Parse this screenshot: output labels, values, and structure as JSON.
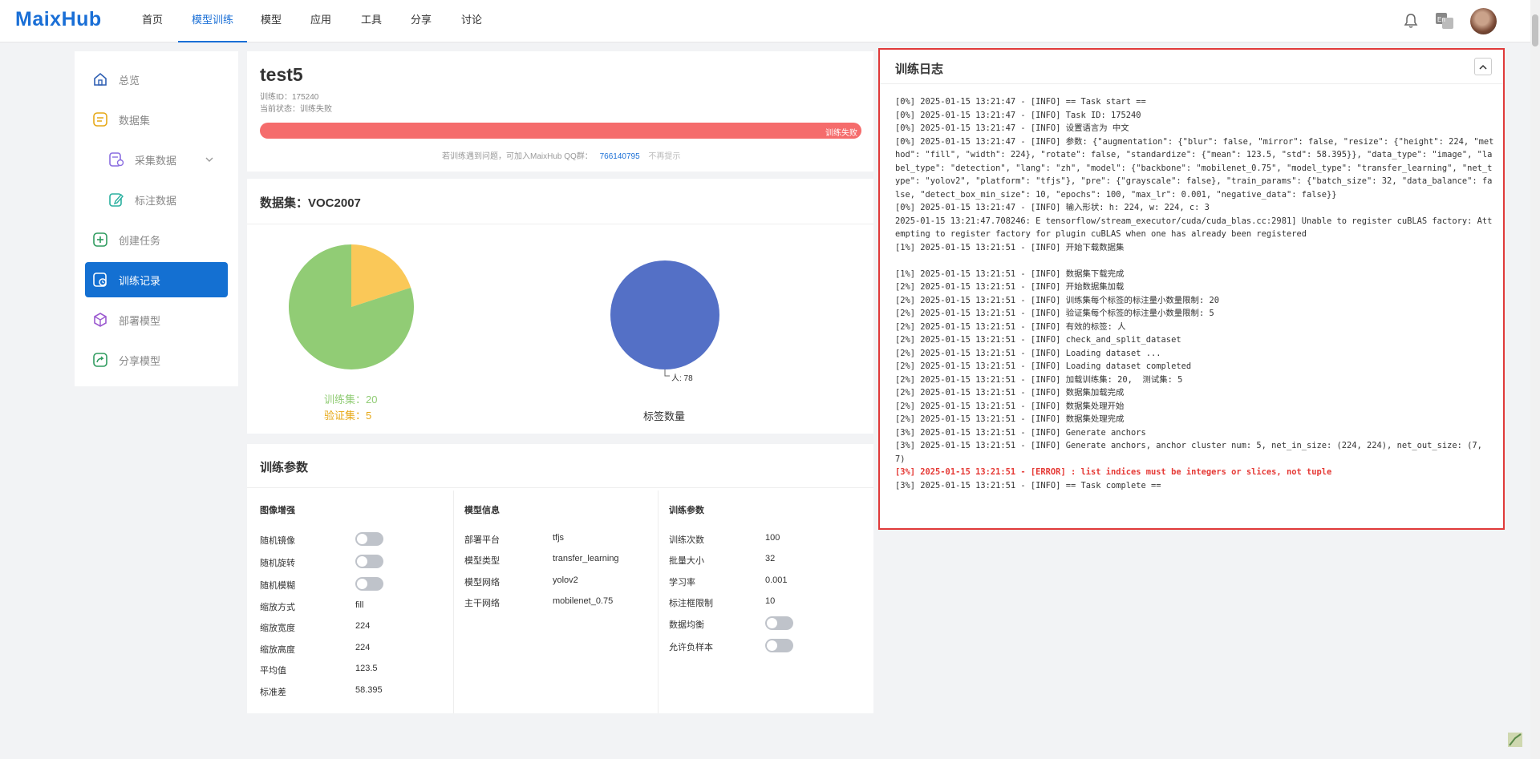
{
  "brand": {
    "logo": "MaixHub"
  },
  "nav": {
    "items": [
      {
        "label": "首页"
      },
      {
        "label": "模型训练"
      },
      {
        "label": "模型"
      },
      {
        "label": "应用"
      },
      {
        "label": "工具"
      },
      {
        "label": "分享"
      },
      {
        "label": "讨论"
      }
    ],
    "active_index": 1,
    "lang_badge": "En"
  },
  "sidebar": {
    "items": [
      {
        "label": "总览",
        "icon": "home-icon"
      },
      {
        "label": "数据集",
        "icon": "dataset-icon"
      },
      {
        "label": "采集数据",
        "icon": "collect-icon"
      },
      {
        "label": "标注数据",
        "icon": "annotate-icon"
      },
      {
        "label": "创建任务",
        "icon": "plus-icon"
      },
      {
        "label": "训练记录",
        "icon": "training-record-icon"
      },
      {
        "label": "部署模型",
        "icon": "cube-icon"
      },
      {
        "label": "分享模型",
        "icon": "share-icon"
      }
    ],
    "active": "训练记录"
  },
  "task": {
    "name": "test5",
    "id_line": "训练ID：175240",
    "status_line": "当前状态：训练失败",
    "progress_text": "训练失败",
    "progress_fraction": 1.0,
    "hint_prefix": "若训练遇到问题，可加入MaixHub QQ群：",
    "qq_group": "766140795",
    "hint_dismiss": "不再提示"
  },
  "dataset": {
    "title": "数据集：VOC2007",
    "split_legend": {
      "train": "训练集：20",
      "val": "验证集：5"
    },
    "label_chart_title": "标签数量",
    "pie_label": "人: 78"
  },
  "chart_data": [
    {
      "type": "pie",
      "labels": [
        "训练集",
        "验证集"
      ],
      "values": [
        20,
        5
      ],
      "colors": [
        "#91cc75",
        "#fac858"
      ]
    },
    {
      "type": "pie",
      "title": "标签数量",
      "labels": [
        "人"
      ],
      "values": [
        78
      ],
      "colors": [
        "#5470c6"
      ]
    }
  ],
  "params": {
    "title": "训练参数",
    "aug": {
      "title": "图像增强",
      "rows": [
        {
          "label": "随机镜像",
          "type": "toggle",
          "on": false
        },
        {
          "label": "随机旋转",
          "type": "toggle",
          "on": false
        },
        {
          "label": "随机模糊",
          "type": "toggle",
          "on": false
        },
        {
          "label": "缩放方式",
          "value": "fill"
        },
        {
          "label": "缩放宽度",
          "value": "224"
        },
        {
          "label": "缩放高度",
          "value": "224"
        },
        {
          "label": "平均值",
          "value": "123.5"
        },
        {
          "label": "标准差",
          "value": "58.395"
        }
      ]
    },
    "model": {
      "title": "模型信息",
      "rows": [
        {
          "label": "部署平台",
          "value": "tfjs"
        },
        {
          "label": "模型类型",
          "value": "transfer_learning"
        },
        {
          "label": "模型网络",
          "value": "yolov2"
        },
        {
          "label": "主干网络",
          "value": "mobilenet_0.75"
        }
      ]
    },
    "train": {
      "title": "训练参数",
      "rows": [
        {
          "label": "训练次数",
          "value": "100"
        },
        {
          "label": "批量大小",
          "value": "32"
        },
        {
          "label": "学习率",
          "value": "0.001"
        },
        {
          "label": "标注框限制",
          "value": "10"
        },
        {
          "label": "数据均衡",
          "type": "toggle",
          "on": false
        },
        {
          "label": "允许负样本",
          "type": "toggle",
          "on": false
        }
      ]
    }
  },
  "log": {
    "title": "训练日志",
    "lines": [
      {
        "text": "[0%] 2025-01-15 13:21:47 - [INFO] == Task start =="
      },
      {
        "text": "[0%] 2025-01-15 13:21:47 - [INFO] Task ID: 175240"
      },
      {
        "text": "[0%] 2025-01-15 13:21:47 - [INFO] 设置语言为 中文"
      },
      {
        "text": "[0%] 2025-01-15 13:21:47 - [INFO] 参数: {\"augmentation\": {\"blur\": false, \"mirror\": false, \"resize\": {\"height\": 224, \"method\": \"fill\", \"width\": 224}, \"rotate\": false, \"standardize\": {\"mean\": 123.5, \"std\": 58.395}}, \"data_type\": \"image\", \"label_type\": \"detection\", \"lang\": \"zh\", \"model\": {\"backbone\": \"mobilenet_0.75\", \"model_type\": \"transfer_learning\", \"net_type\": \"yolov2\", \"platform\": \"tfjs\"}, \"pre\": {\"grayscale\": false}, \"train_params\": {\"batch_size\": 32, \"data_balance\": false, \"detect_box_min_size\": 10, \"epochs\": 100, \"max_lr\": 0.001, \"negative_data\": false}}"
      },
      {
        "text": "[0%] 2025-01-15 13:21:47 - [INFO] 输入形状: h: 224, w: 224, c: 3"
      },
      {
        "text": "2025-01-15 13:21:47.708246: E tensorflow/stream_executor/cuda/cuda_blas.cc:2981] Unable to register cuBLAS factory: Attempting to register factory for plugin cuBLAS when one has already been registered"
      },
      {
        "text": "[1%] 2025-01-15 13:21:51 - [INFO] 开始下载数据集"
      },
      {
        "text": ""
      },
      {
        "text": "[1%] 2025-01-15 13:21:51 - [INFO] 数据集下载完成"
      },
      {
        "text": "[2%] 2025-01-15 13:21:51 - [INFO] 开始数据集加载"
      },
      {
        "text": "[2%] 2025-01-15 13:21:51 - [INFO] 训练集每个标签的标注量小数量限制: 20"
      },
      {
        "text": "[2%] 2025-01-15 13:21:51 - [INFO] 验证集每个标签的标注量小数量限制: 5"
      },
      {
        "text": "[2%] 2025-01-15 13:21:51 - [INFO] 有效的标签: 人"
      },
      {
        "text": "[2%] 2025-01-15 13:21:51 - [INFO] check_and_split_dataset"
      },
      {
        "text": "[2%] 2025-01-15 13:21:51 - [INFO] Loading dataset ..."
      },
      {
        "text": "[2%] 2025-01-15 13:21:51 - [INFO] Loading dataset completed"
      },
      {
        "text": "[2%] 2025-01-15 13:21:51 - [INFO] 加载训练集: 20,  测试集: 5"
      },
      {
        "text": "[2%] 2025-01-15 13:21:51 - [INFO] 数据集加载完成"
      },
      {
        "text": "[2%] 2025-01-15 13:21:51 - [INFO] 数据集处理开始"
      },
      {
        "text": "[2%] 2025-01-15 13:21:51 - [INFO] 数据集处理完成"
      },
      {
        "text": "[3%] 2025-01-15 13:21:51 - [INFO] Generate anchors"
      },
      {
        "text": "[3%] 2025-01-15 13:21:51 - [INFO] Generate anchors, anchor cluster num: 5, net_in_size: (224, 224), net_out_size: (7, 7)"
      },
      {
        "text": "[3%] 2025-01-15 13:21:51 - [ERROR] : list indices must be integers or slices, not tuple",
        "level": "error"
      },
      {
        "text": "[3%] 2025-01-15 13:21:51 - [INFO] == Task complete =="
      }
    ]
  }
}
